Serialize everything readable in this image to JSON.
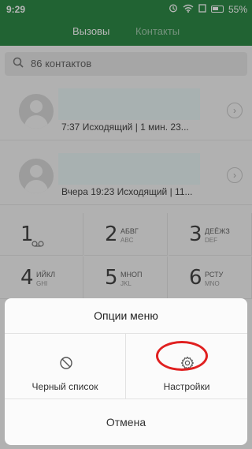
{
  "status": {
    "time": "9:29",
    "battery": "55%",
    "icons": [
      "alarm-icon",
      "wifi-icon",
      "sim-icon",
      "battery-icon"
    ]
  },
  "tabs": [
    {
      "label": "Вызовы",
      "active": true
    },
    {
      "label": "Контакты",
      "active": false
    }
  ],
  "search": {
    "placeholder": "86 контактов"
  },
  "calls": [
    {
      "detail": "7:37 Исходящий | 1 мин. 23..."
    },
    {
      "detail": "Вчера 19:23 Исходящий | 11..."
    }
  ],
  "keypad": [
    {
      "digit": "1",
      "cyr": "",
      "lat": "",
      "icon": "voicemail-icon"
    },
    {
      "digit": "2",
      "cyr": "АБВГ",
      "lat": "ABC"
    },
    {
      "digit": "3",
      "cyr": "ДЕЁЖЗ",
      "lat": "DEF"
    },
    {
      "digit": "4",
      "cyr": "ИЙКЛ",
      "lat": "GHI"
    },
    {
      "digit": "5",
      "cyr": "МНОП",
      "lat": "JKL"
    },
    {
      "digit": "6",
      "cyr": "РСТУ",
      "lat": "MNO"
    }
  ],
  "menu": {
    "title": "Опции меню",
    "options": [
      {
        "label": "Черный список",
        "icon": "block-icon"
      },
      {
        "label": "Настройки",
        "icon": "gear-icon"
      }
    ],
    "cancel": "Отмена"
  },
  "colors": {
    "header": "#2f8a47",
    "highlight": "#e02020"
  }
}
